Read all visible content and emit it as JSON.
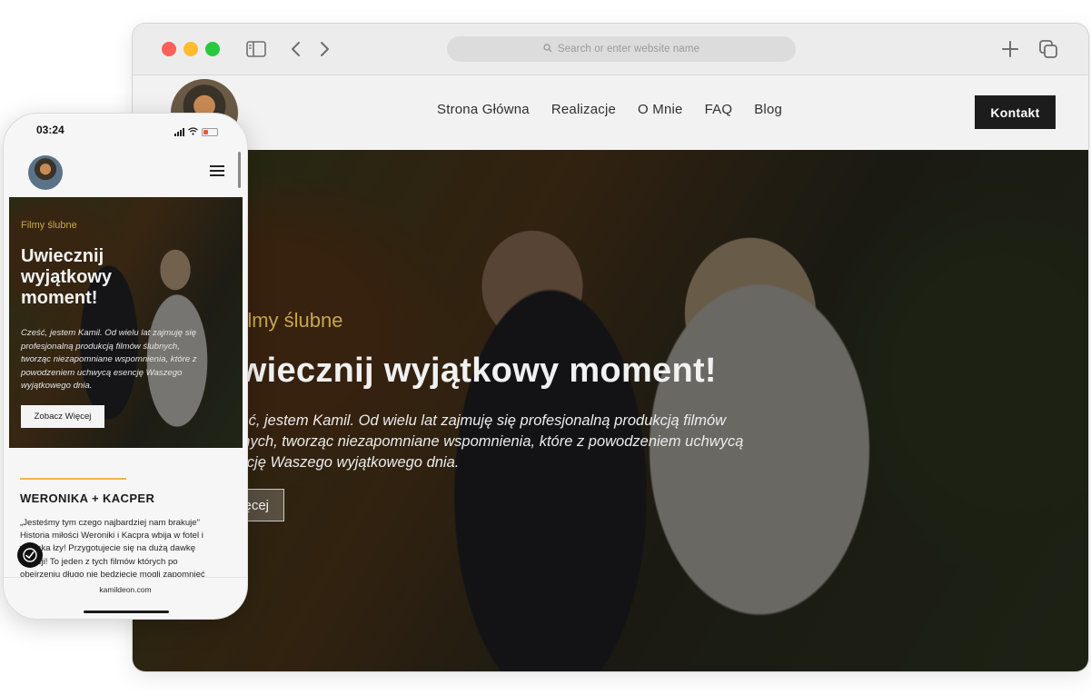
{
  "desktop": {
    "browser": {
      "address_placeholder": "Search or enter website name"
    },
    "header": {
      "nav": [
        "Strona Główna",
        "Realizacje",
        "O Mnie",
        "FAQ",
        "Blog"
      ],
      "contact_button": "Kontakt"
    },
    "hero": {
      "tag": "Filmy ślubne",
      "title": "Uwiecznij wyjątkowy moment!",
      "description_lines": [
        "Cześć, jestem Kamil. Od wielu lat zajmuję się profesjonalną produkcją filmów",
        "ślubnych, tworząc niezapomniane wspomnienia, które z powodzeniem uchwycą",
        "esencję Waszego wyjątkowego dnia."
      ],
      "button": "Zobacz Więcej"
    }
  },
  "mobile": {
    "status": {
      "time": "03:24"
    },
    "hero": {
      "tag": "Filmy ślubne",
      "title_lines": [
        "Uwiecznij",
        "wyjątkowy",
        "moment!"
      ],
      "description_lines": [
        "Cześć, jestem Kamil. Od wielu lat zajmuję się",
        "profesjonalną produkcją filmów ślubnych,",
        "tworząc niezapomniane wspomnienia, które z",
        "powodzeniem uchwycą esencję Waszego",
        "wyjątkowego dnia."
      ],
      "button": "Zobacz Więcej"
    },
    "story": {
      "title": "WERONIKA + KACPER",
      "lines": [
        "„Jesteśmy tym czego najbardziej nam brakuje\"",
        "Historia miłości Weroniki i Kacpra wbija w fotel i",
        "wyciska łzy! Przygotujecie się na dużą dawkę",
        "emocji! To jeden z tych filmów których po",
        "obejrzeniu długo nie będziecie mogli zapomnieć"
      ]
    },
    "browser": {
      "url": "kamildeon.com"
    }
  },
  "colors": {
    "accent_gold": "#c9a64c",
    "divider_gold": "#e8b64a",
    "contact_button_bg": "#1c1c1c"
  },
  "icons": [
    "sidebar-icon",
    "back-arrow-icon",
    "forward-arrow-icon",
    "search-icon",
    "plus-icon",
    "tabs-icon",
    "hamburger-menu-icon",
    "accessibility-icon",
    "wifi-icon",
    "signal-icon",
    "battery-icon"
  ]
}
